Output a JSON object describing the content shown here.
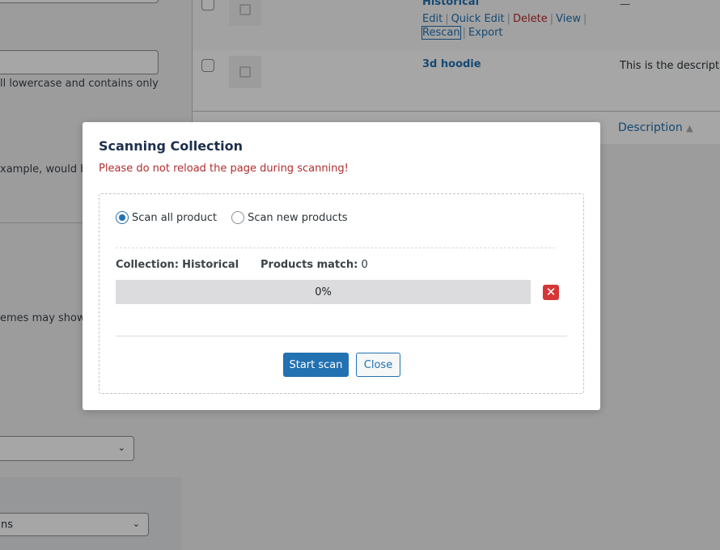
{
  "background": {
    "left_texts": {
      "lowercase_note": "ll lowercase and contains only",
      "example_note": "xample, would be",
      "themes_note": "emes may show it."
    },
    "select_bottom_value": "ns",
    "table": {
      "rows": [
        {
          "title": "Historical",
          "dash": "—",
          "actions": {
            "edit": "Edit",
            "quick_edit": "Quick Edit",
            "delete": "Delete",
            "view": "View",
            "rescan": "Rescan",
            "export": "Export",
            "separator": "|"
          }
        },
        {
          "title": "3d hoodie",
          "description": "This is the description"
        }
      ],
      "footer_column": "Description",
      "sort_icon": "sort-arrows-icon"
    }
  },
  "modal": {
    "title": "Scanning Collection",
    "warning": "Please do not reload the page during scanning!",
    "scan_options": [
      {
        "label": "Scan all product",
        "selected": true
      },
      {
        "label": "Scan new products",
        "selected": false
      }
    ],
    "collection_label": "Collection:",
    "collection_value": "Historical",
    "products_match_label": "Products match:",
    "products_match_value": "0",
    "progress": {
      "value": 0,
      "text": "0%"
    },
    "cancel_icon": "close-x-icon",
    "start_button": "Start scan",
    "close_button": "Close",
    "colors": {
      "primary": "#2271b1",
      "danger": "#d63638",
      "warning_text": "#b32d2e",
      "title": "#1d2f4c"
    }
  }
}
